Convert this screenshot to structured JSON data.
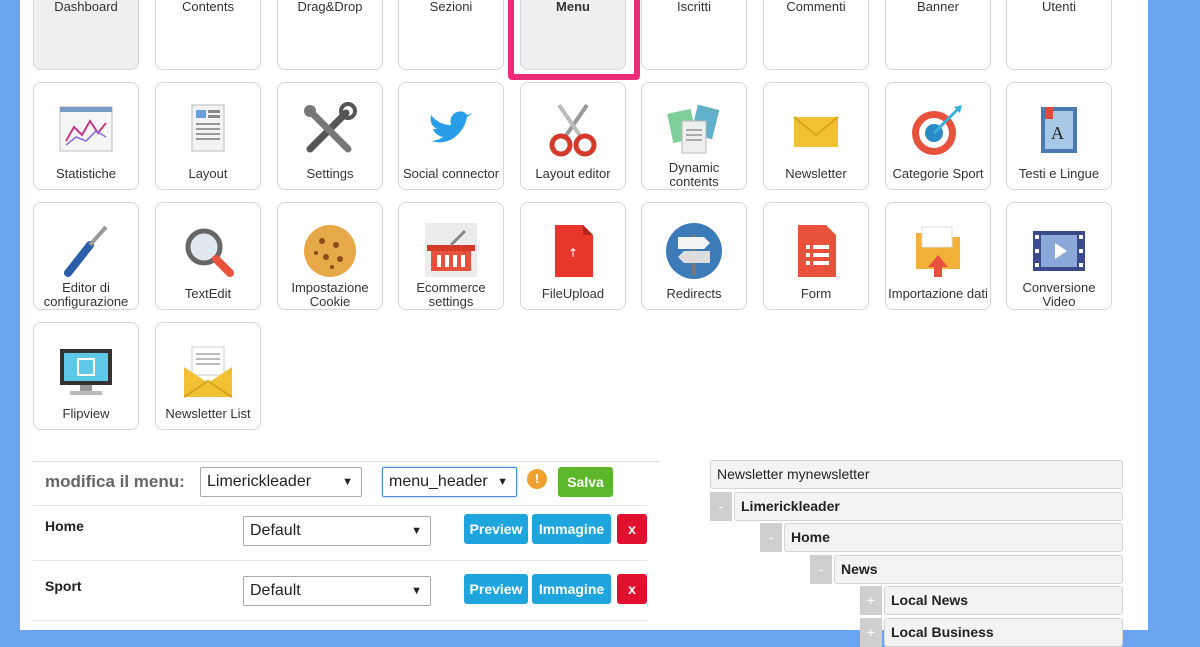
{
  "tiles_row1": [
    {
      "label": "Dashboard",
      "icon": "dashboard-icon"
    },
    {
      "label": "Contents",
      "icon": "pencil-icon"
    },
    {
      "label": "Drag&Drop",
      "icon": "drag-drop-icon"
    },
    {
      "label": "Sezioni",
      "icon": "folders-icon"
    },
    {
      "label": "Menu",
      "icon": "menu-icon"
    },
    {
      "label": "Iscritti",
      "icon": "user-icon"
    },
    {
      "label": "Commenti",
      "icon": "comment-icon"
    },
    {
      "label": "Banner",
      "icon": "banner-icon"
    },
    {
      "label": "Utenti",
      "icon": "users-icon"
    }
  ],
  "tiles_row2": [
    {
      "label": "Statistiche",
      "icon": "stats-icon"
    },
    {
      "label": "Layout",
      "icon": "layout-icon"
    },
    {
      "label": "Settings",
      "icon": "tools-icon"
    },
    {
      "label": "Social connector",
      "icon": "twitter-icon"
    },
    {
      "label": "Layout editor",
      "icon": "scissors-icon"
    },
    {
      "label": "Dynamic contents",
      "icon": "documents-icon"
    },
    {
      "label": "Newsletter",
      "icon": "envelope-icon"
    },
    {
      "label": "Categorie Sport",
      "icon": "target-icon"
    },
    {
      "label": "Testi e Lingue",
      "icon": "book-icon"
    }
  ],
  "tiles_row3": [
    {
      "label": "Editor di configurazione",
      "icon": "screwdriver-icon"
    },
    {
      "label": "TextEdit",
      "icon": "magnifier-icon"
    },
    {
      "label": "Impostazione Cookie",
      "icon": "cookie-icon"
    },
    {
      "label": "Ecommerce settings",
      "icon": "basket-icon"
    },
    {
      "label": "FileUpload",
      "icon": "file-upload-icon"
    },
    {
      "label": "Redirects",
      "icon": "signpost-icon"
    },
    {
      "label": "Form",
      "icon": "form-icon"
    },
    {
      "label": "Importazione dati",
      "icon": "import-folder-icon"
    },
    {
      "label": "Conversione Video",
      "icon": "video-icon"
    }
  ],
  "tiles_row4": [
    {
      "label": "Flipview",
      "icon": "monitor-icon"
    },
    {
      "label": "Newsletter List",
      "icon": "open-envelope-icon"
    }
  ],
  "menu_editor": {
    "label": "modifica il menu:",
    "site_select": "Limerickleader",
    "menu_select": "menu_header",
    "warning_glyph": "!",
    "save_label": "Salva",
    "items": [
      {
        "name": "Home",
        "layout": "Default",
        "preview": "Preview",
        "image": "Immagine",
        "delete": "x"
      },
      {
        "name": "Sport",
        "layout": "Default",
        "preview": "Preview",
        "image": "Immagine",
        "delete": "x"
      }
    ]
  },
  "tree": {
    "root": "Newsletter mynewsletter",
    "nodes": [
      {
        "label": "Limerickleader",
        "toggle": "-"
      },
      {
        "label": "Home",
        "toggle": "-"
      },
      {
        "label": "News",
        "toggle": "-"
      },
      {
        "label": "Local News",
        "toggle": "+"
      },
      {
        "label": "Local Business",
        "toggle": "+"
      }
    ]
  },
  "colors": {
    "accent_highlight": "#ee2b7b",
    "save": "#5cb82a",
    "action": "#1fa5de",
    "delete": "#e0102e",
    "background": "#6aa3f0"
  }
}
